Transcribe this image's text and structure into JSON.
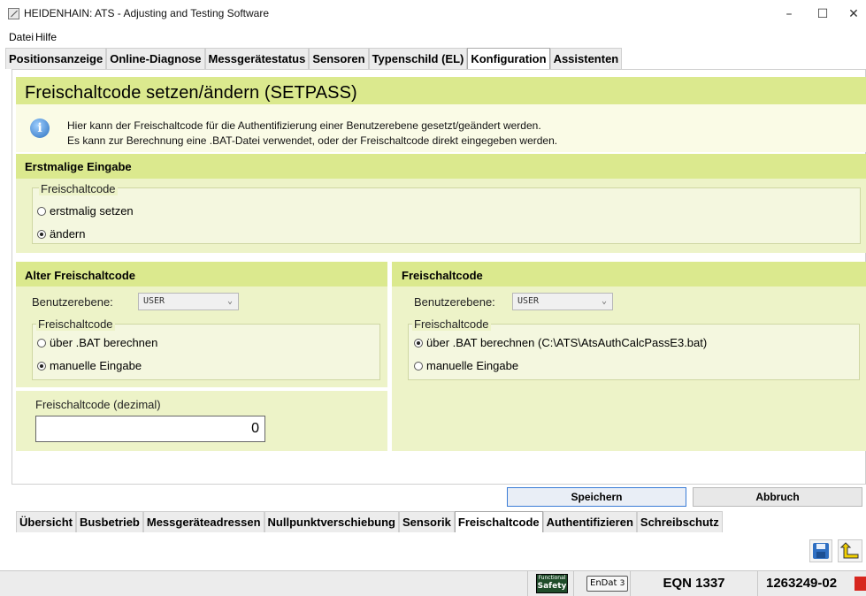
{
  "window": {
    "title": "HEIDENHAIN: ATS - Adjusting and Testing Software",
    "minimize": "–",
    "maximize": "☐",
    "close": "✕"
  },
  "menu": [
    "Datei",
    "Hilfe"
  ],
  "top_tabs": [
    "Positionsanzeige",
    "Online-Diagnose",
    "Messgerätestatus",
    "Sensoren",
    "Typenschild (EL)",
    "Konfiguration",
    "Assistenten"
  ],
  "active_top_tab": "Konfiguration",
  "header": {
    "title": "Freischaltcode setzen/ändern (SETPASS)",
    "info_line1": "Hier kann der Freischaltcode für die Authentifizierung einer Benutzerebene gesetzt/geändert werden.",
    "info_line2": "Es kann zur Berechnung eine .BAT-Datei verwendet, oder der Freischaltcode direkt eingegeben werden."
  },
  "erstmalig": {
    "heading": "Erstmalige Eingabe",
    "group_label": "Freischaltcode",
    "opt1": "erstmalig setzen",
    "opt2": "ändern",
    "selected": "ändern"
  },
  "alt": {
    "heading": "Alter Freischaltcode",
    "benutzer_label": "Benutzerebene:",
    "benutzer_value": "USER",
    "group_label": "Freischaltcode",
    "opt1": "über .BAT berechnen",
    "opt2": "manuelle Eingabe",
    "selected": "manuelle Eingabe",
    "decimal_label": "Freischaltcode (dezimal)",
    "decimal_value": "0"
  },
  "neu": {
    "heading": "Freischaltcode",
    "benutzer_label": "Benutzerebene:",
    "benutzer_value": "USER",
    "group_label": "Freischaltcode",
    "opt1": "über .BAT berechnen (C:\\ATS\\AtsAuthCalcPassE3.bat)",
    "opt2": "manuelle Eingabe",
    "selected": "über .BAT berechnen"
  },
  "buttons": {
    "save": "Speichern",
    "cancel": "Abbruch"
  },
  "bottom_tabs": [
    "Übersicht",
    "Busbetrieb",
    "Messgeräteadressen",
    "Nullpunktverschiebung",
    "Sensorik",
    "Freischaltcode",
    "Authentifizieren",
    "Schreibschutz"
  ],
  "active_bottom_tab": "Freischaltcode",
  "status": {
    "functional": "Functional",
    "safety": "Safety",
    "endat": "EnDat",
    "endat_ver": "3",
    "device": "EQN 1337",
    "id": "1263249-02"
  },
  "colors": {
    "accent_green": "#dbe98e",
    "panel_green": "#edf3c8",
    "primary_border": "#3a7cd6"
  }
}
